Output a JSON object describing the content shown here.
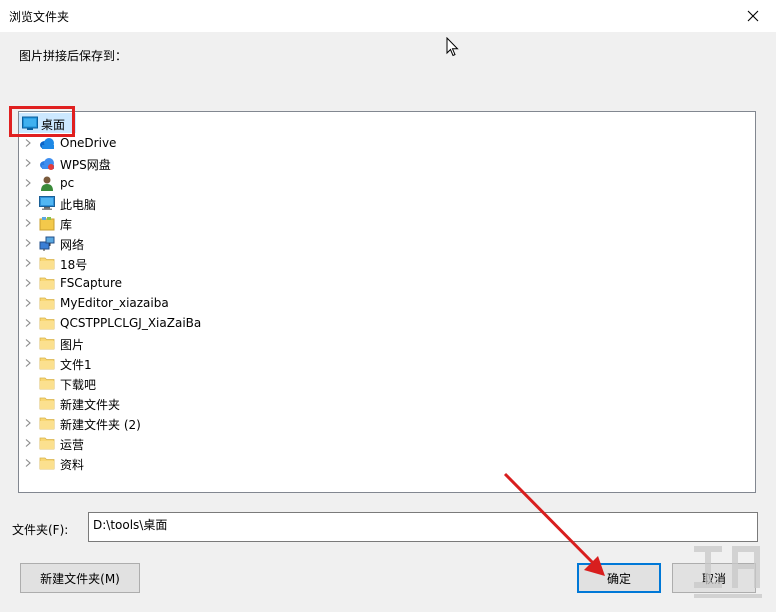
{
  "dialog": {
    "title": "浏览文件夹",
    "instruction": "图片拼接后保存到："
  },
  "tree": {
    "root": {
      "label": "桌面",
      "icon": "desktop-icon",
      "selected": true
    },
    "items": [
      {
        "label": "OneDrive",
        "icon": "onedrive-cloud-icon",
        "expandable": true
      },
      {
        "label": "WPS网盘",
        "icon": "wps-cloud-icon",
        "expandable": true
      },
      {
        "label": "pc",
        "icon": "user-icon",
        "expandable": true
      },
      {
        "label": "此电脑",
        "icon": "computer-icon",
        "expandable": true
      },
      {
        "label": "库",
        "icon": "library-icon",
        "expandable": true
      },
      {
        "label": "网络",
        "icon": "network-icon",
        "expandable": true
      },
      {
        "label": "18号",
        "icon": "folder-icon",
        "expandable": true
      },
      {
        "label": "FSCapture",
        "icon": "folder-icon",
        "expandable": true
      },
      {
        "label": "MyEditor_xiazaiba",
        "icon": "folder-icon",
        "expandable": true
      },
      {
        "label": "QCSTPPLCLGJ_XiaZaiBa",
        "icon": "folder-icon",
        "expandable": true
      },
      {
        "label": "图片",
        "icon": "folder-icon",
        "expandable": true
      },
      {
        "label": "文件1",
        "icon": "folder-icon",
        "expandable": true
      },
      {
        "label": "下载吧",
        "icon": "folder-icon",
        "expandable": false
      },
      {
        "label": "新建文件夹",
        "icon": "folder-icon",
        "expandable": false
      },
      {
        "label": "新建文件夹 (2)",
        "icon": "folder-icon",
        "expandable": true
      },
      {
        "label": "运营",
        "icon": "folder-icon",
        "expandable": true
      },
      {
        "label": "资料",
        "icon": "folder-icon",
        "expandable": true
      }
    ]
  },
  "folder_field": {
    "label": "文件夹(F):",
    "value": "D:\\tools\\桌面"
  },
  "buttons": {
    "new_folder": "新建文件夹(M)",
    "ok": "确定",
    "cancel": "取消"
  },
  "colors": {
    "selection": "#cce8ff",
    "annotation_red": "#e02020",
    "focus_blue": "#0078d7",
    "folder_yellow": "#f8d775"
  }
}
